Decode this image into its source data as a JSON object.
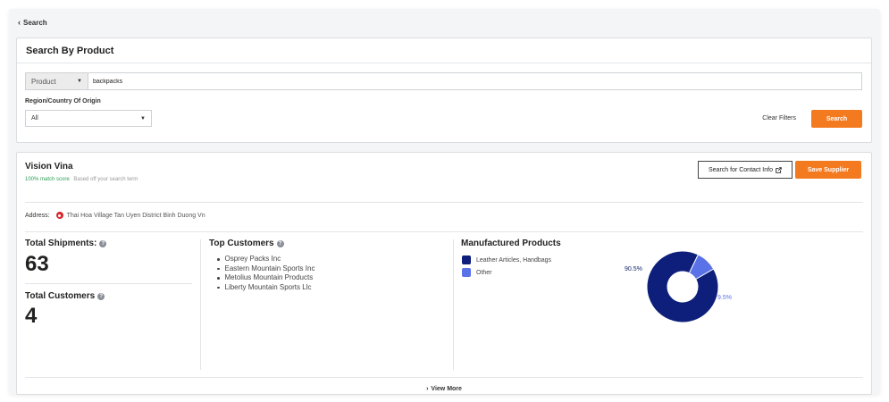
{
  "nav": {
    "back_label": "Search"
  },
  "search_panel": {
    "title": "Search By Product",
    "product_type": "Product",
    "query": "backpacks",
    "region_label": "Region/Country Of Origin",
    "region_value": "All",
    "clear_label": "Clear Filters",
    "search_label": "Search"
  },
  "supplier": {
    "name": "Vision Vina",
    "match_score": "100% match score",
    "match_note": "Based off your search term",
    "contact_label": "Search for Contact Info",
    "save_label": "Save Supplier",
    "address_label": "Address:",
    "address": "Thai Hoa Village Tan Uyen District Binh Duong Vn",
    "shipments_title": "Total Shipments:",
    "shipments": "63",
    "customers_title": "Total Customers",
    "customers": "4",
    "top_customers_title": "Top Customers",
    "top_customers": [
      "Osprey Packs Inc",
      "Eastern Mountain Sports Inc",
      "Metolius Mountain Products",
      "Liberty Mountain Sports Llc"
    ],
    "products_title": "Manufactured Products",
    "view_more": "View More"
  },
  "chart_data": {
    "type": "pie",
    "categories": [
      "Leather Articles, Handbags",
      "Other"
    ],
    "values": [
      90.5,
      9.5
    ],
    "labels": [
      "90.5%",
      "9.5%"
    ],
    "colors": [
      "#0d1f7a",
      "#5a72e8"
    ]
  }
}
